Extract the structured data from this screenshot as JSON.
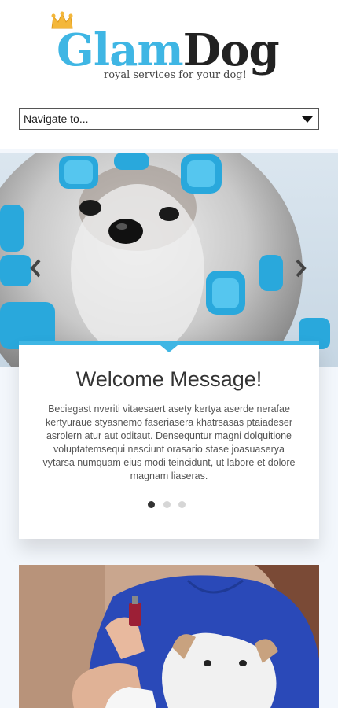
{
  "brand": {
    "logo_glam": "Glam",
    "logo_dog": "Dog",
    "tagline": "royal services for your dog!"
  },
  "nav": {
    "label": "Navigate to..."
  },
  "slider": {
    "title": "Welcome Message!",
    "body": "Beciegast nveriti vitaesaert asety kertya aserde nerafae kertyuraue styasnemo faseriasera khatrsasas ptaiadeser asrolern atur aut oditaut. Densequntur magni dolquitione voluptatemsequi nesciunt orasario stase joasuaserya vytarsa numquam eius modi teincidunt, ut labore et dolore magnam liaseras.",
    "slide_count": 3,
    "active_slide": 1
  },
  "colors": {
    "accent": "#3fb6e4",
    "dark": "#222222"
  },
  "icons": {
    "prev": "chevron-left-icon",
    "next": "chevron-right-icon",
    "select": "caret-down-icon",
    "crown": "crown-icon"
  }
}
